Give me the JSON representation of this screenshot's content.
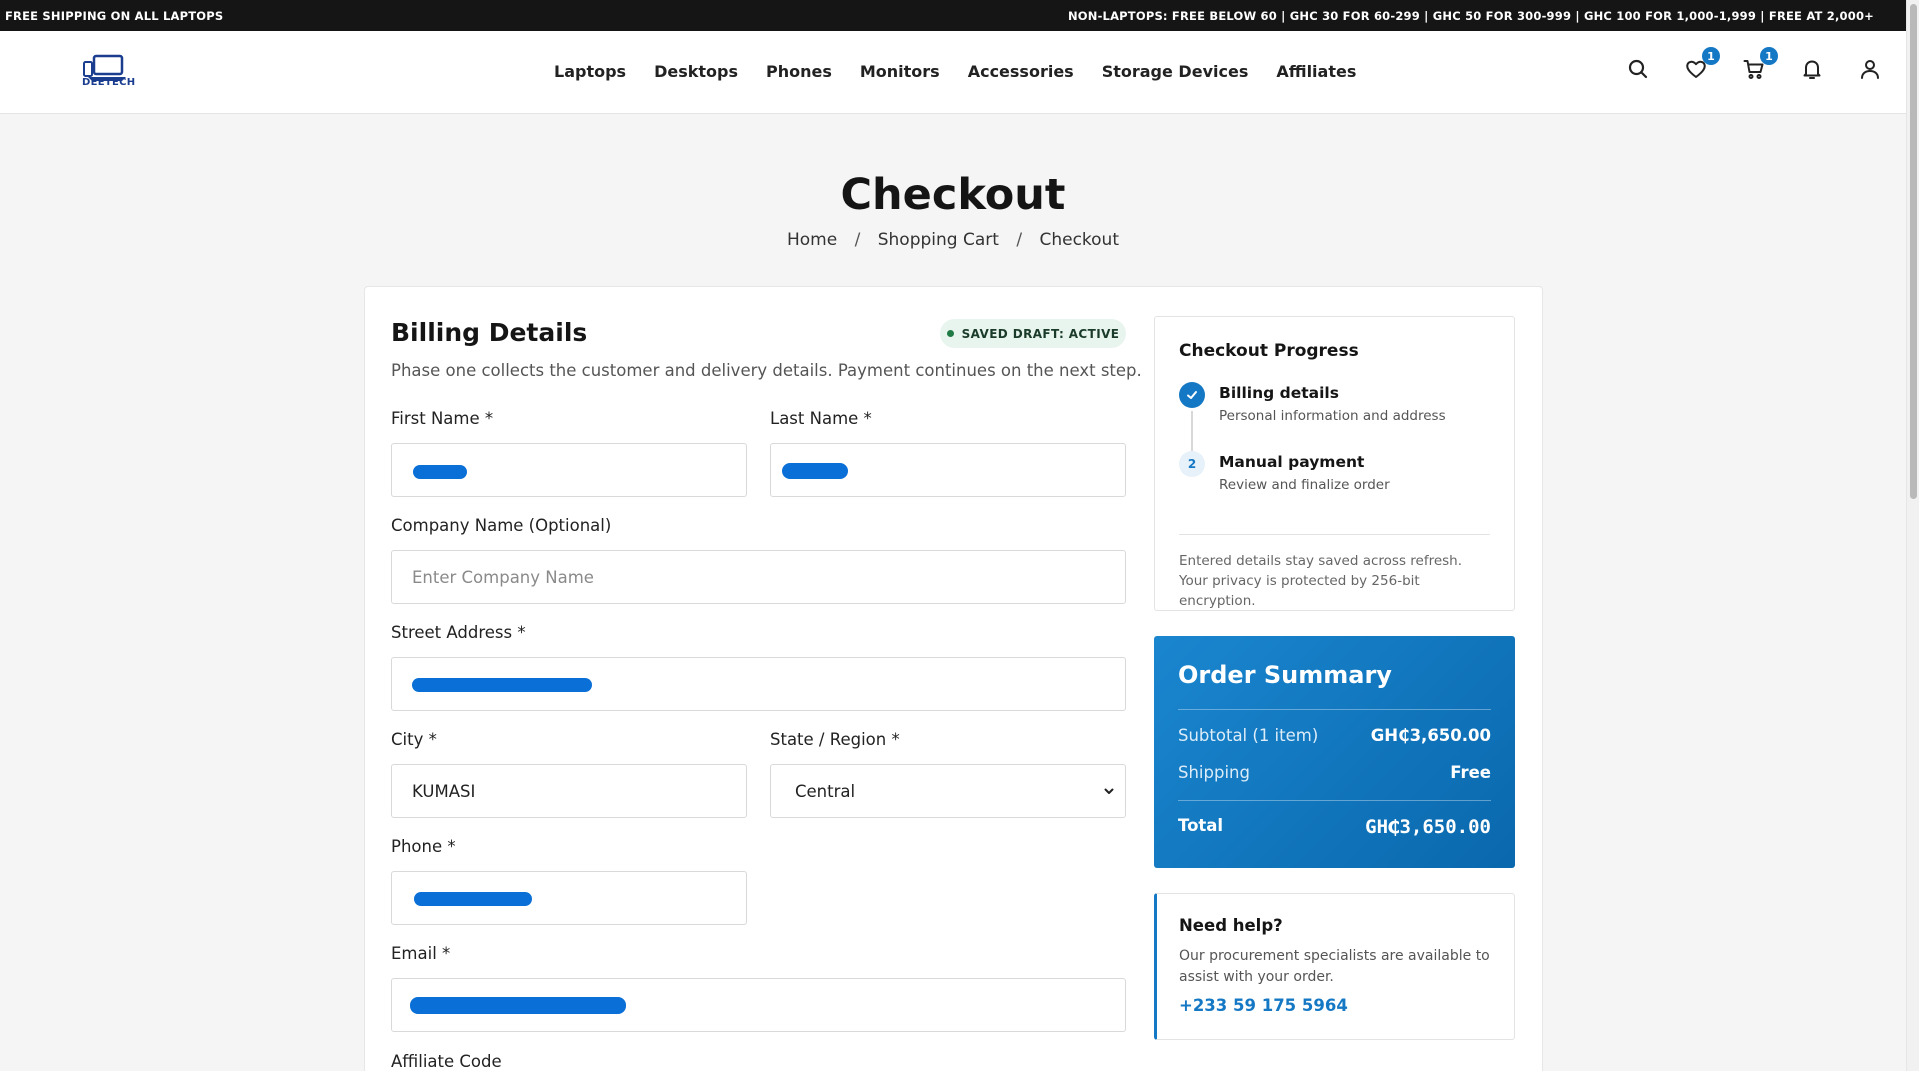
{
  "topbar": {
    "left": "FREE SHIPPING ON ALL LAPTOPS",
    "right": "NON-LAPTOPS: FREE BELOW 60 | GHC 30 FOR 60-299 | GHC 50 FOR 300-999 | GHC 100 FOR 1,000-1,999 | FREE AT 2,000+"
  },
  "header": {
    "logo_text": "DEETECH",
    "nav": [
      "Laptops",
      "Desktops",
      "Phones",
      "Monitors",
      "Accessories",
      "Storage Devices",
      "Affiliates"
    ],
    "wishlist_count": "1",
    "cart_count": "1",
    "icons": [
      "search-icon",
      "heart-icon",
      "cart-icon",
      "bell-icon",
      "user-icon"
    ],
    "accent_color": "#1478c4"
  },
  "page": {
    "title": "Checkout",
    "breadcrumb": [
      "Home",
      "Shopping Cart",
      "Checkout"
    ],
    "breadcrumb_sep": "/"
  },
  "billing": {
    "title": "Billing Details",
    "draft_badge": "SAVED DRAFT: ACTIVE",
    "intro": "Phase one collects the customer and delivery details. Payment continues on the next step.",
    "first_name_label": "First Name *",
    "last_name_label": "Last Name *",
    "company_label": "Company Name (Optional)",
    "company_placeholder": "Enter Company Name",
    "street_label": "Street Address *",
    "city_label": "City *",
    "city_value": "KUMASI",
    "state_label": "State / Region *",
    "state_value": "Central",
    "phone_label": "Phone *",
    "email_label": "Email *",
    "affiliate_label": "Affiliate Code"
  },
  "progress": {
    "title": "Checkout Progress",
    "steps": [
      {
        "title": "Billing details",
        "subtitle": "Personal information and address",
        "state": "done"
      },
      {
        "number": "2",
        "title": "Manual payment",
        "subtitle": "Review and finalize order",
        "state": "todo"
      }
    ],
    "note": "Entered details stay saved across refresh. Your privacy is protected by 256-bit encryption."
  },
  "summary": {
    "title": "Order Summary",
    "subtotal_label": "Subtotal (1 item)",
    "subtotal_value": "GH₵3,650.00",
    "shipping_label": "Shipping",
    "shipping_value": "Free",
    "total_label": "Total",
    "total_value": "GH₵3,650.00"
  },
  "help": {
    "title": "Need help?",
    "text": "Our procurement specialists are available to assist with your order.",
    "phone": "+233 59 175 5964"
  }
}
